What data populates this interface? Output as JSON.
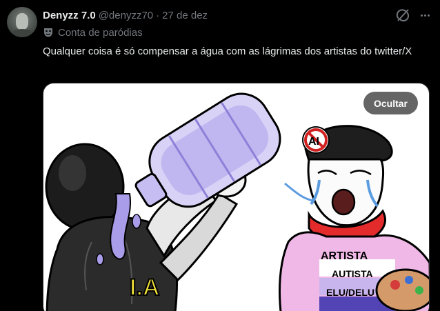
{
  "post": {
    "author": {
      "display_name": "Denyzz 7.0",
      "handle": "@denyzz70",
      "separator": "·",
      "date": "27 de dez",
      "parody_label": "Conta de paródias"
    },
    "text": "Qualquer coisa é só compensar a água com as lágrimas dos artistas do twitter/X",
    "media": {
      "hide_button_label": "Ocultar",
      "drawn_text": {
        "robot_chest": "I.A",
        "beret_badge": "AI",
        "shirt_line1": "ARTISTA",
        "shirt_line2": "AUTISTA",
        "shirt_line3": "ELU/DELU"
      }
    }
  },
  "icons": {
    "grok": "grok-icon",
    "more": "more-icon",
    "parody": "theater-mask-icon"
  },
  "colors": {
    "background": "#000000",
    "primary_text": "#e7e9ea",
    "secondary_text": "#71767b",
    "border": "#2f3336",
    "water": "#a99ce8",
    "scarf_red": "#e32b2b",
    "hide_button_bg": "#505050"
  }
}
